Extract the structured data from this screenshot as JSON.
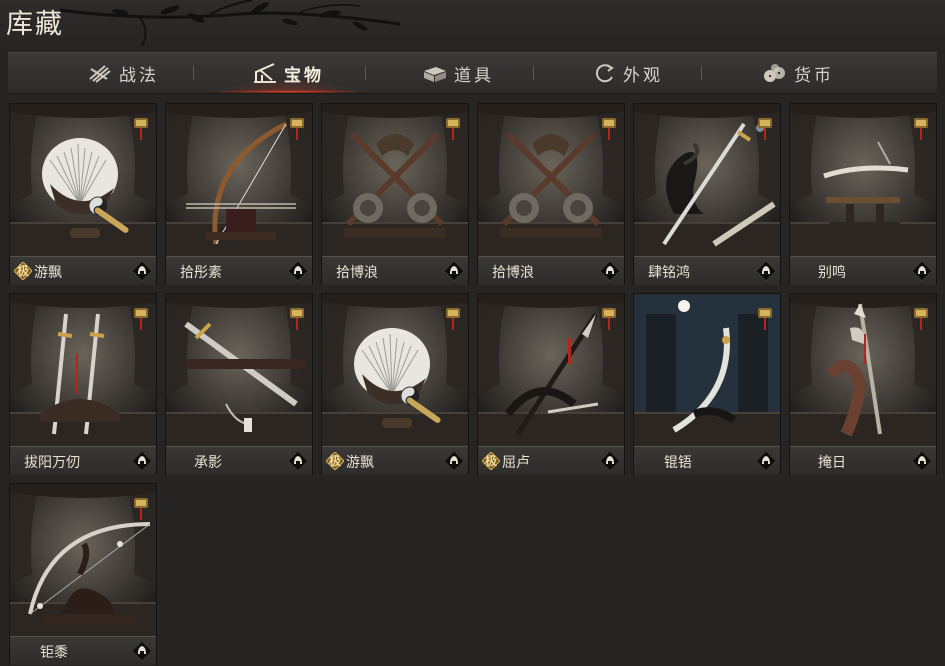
{
  "page": {
    "title": "库藏"
  },
  "tabs": [
    {
      "id": "zhanfa",
      "label": "战法",
      "icon": "scroll-bundle-icon",
      "active": false
    },
    {
      "id": "baowu",
      "label": "宝物",
      "icon": "weapon-rack-icon",
      "active": true
    },
    {
      "id": "daoju",
      "label": "道具",
      "icon": "box-icon",
      "active": false
    },
    {
      "id": "waiguan",
      "label": "外观",
      "icon": "swirl-icon",
      "active": false
    },
    {
      "id": "huobi",
      "label": "货币",
      "icon": "coins-icon",
      "active": false
    }
  ],
  "items": [
    {
      "name": "游飘",
      "grade": "极",
      "art": "feather-fan"
    },
    {
      "name": "拾彤素",
      "grade": "",
      "art": "bow"
    },
    {
      "name": "拾博浪",
      "grade": "",
      "art": "hammers"
    },
    {
      "name": "拾博浪",
      "grade": "",
      "art": "hammers"
    },
    {
      "name": "肆铭鸿",
      "grade": "",
      "art": "dragon-sword"
    },
    {
      "name": "别鸣",
      "grade": "",
      "art": "sword-stand"
    },
    {
      "name": "拔阳万仞",
      "grade": "",
      "art": "twin-swords"
    },
    {
      "name": "承影",
      "grade": "",
      "art": "straight-sword"
    },
    {
      "name": "游飘",
      "grade": "极",
      "art": "feather-fan"
    },
    {
      "name": "屈卢",
      "grade": "极",
      "art": "spear"
    },
    {
      "name": "锟铻",
      "grade": "",
      "art": "scimitar-night"
    },
    {
      "name": "掩日",
      "grade": "",
      "art": "halberd"
    },
    {
      "name": "钜黍",
      "grade": "",
      "art": "bow-dragon"
    }
  ],
  "colors": {
    "accent": "#e0452e",
    "gold": "#c9a24a",
    "panel": "#262524"
  }
}
